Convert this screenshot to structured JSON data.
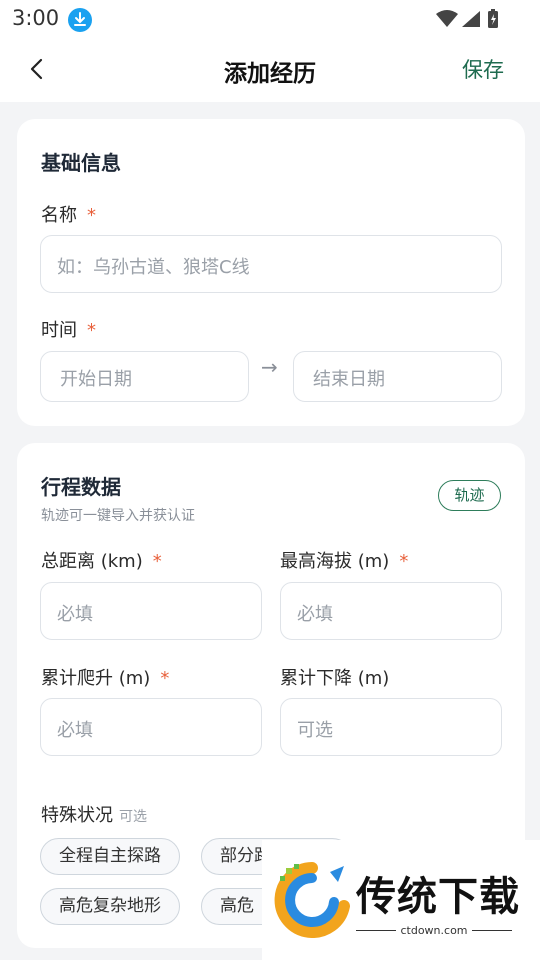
{
  "status_bar": {
    "time": "3:00"
  },
  "app_bar": {
    "title": "添加经历",
    "save_label": "保存"
  },
  "basic_card": {
    "title": "基础信息",
    "name_label": "名称",
    "required_mark": "*",
    "name_placeholder": "如：乌孙古道、狼塔C线",
    "time_label": "时间",
    "start_placeholder": "开始日期",
    "arrow": "→",
    "end_placeholder": "结束日期"
  },
  "trip_card": {
    "title": "行程数据",
    "subtitle": "轨迹可一键导入并获认证",
    "track_chip": "轨迹",
    "distance_label": "总距离 (km)",
    "altitude_label": "最高海拔 (m)",
    "ascent_label": "累计爬升 (m)",
    "descent_label": "累计下降 (m)",
    "required_placeholder": "必填",
    "optional_placeholder": "可选",
    "special_label": "特殊状况",
    "special_optional": "可选",
    "tags": [
      "全程自主探路",
      "部分路",
      "高危复杂地形",
      "高危"
    ]
  },
  "watermark": {
    "brand": "传统下载",
    "url": "ctdown.com"
  }
}
